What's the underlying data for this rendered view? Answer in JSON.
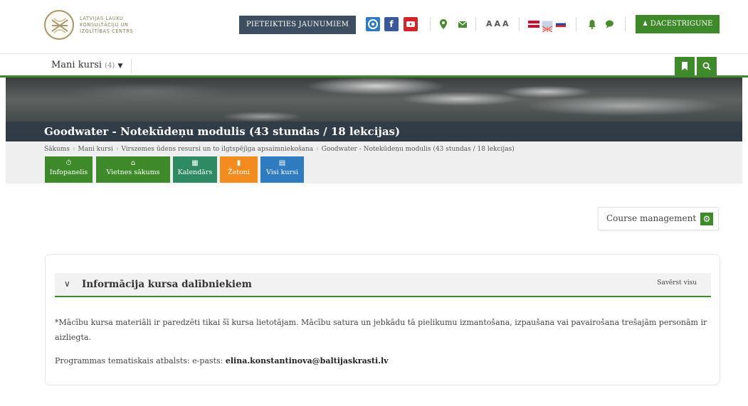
{
  "brand": {
    "logo_lines": [
      "LATVIJAS LAUKU",
      "KONSULTĀCIJU UN",
      "IZGLĪTĪBAS CENTRS"
    ],
    "accent": "#3e8a2a",
    "dark": "#3c4e5f"
  },
  "header": {
    "join_label": "PIETEIKTIES JAUNUMIEM",
    "font_sizes_label": "AAA",
    "user_label": "DACESTRIGUNE",
    "icons": [
      "draugiem-icon",
      "facebook-icon",
      "youtube-icon",
      "location-icon",
      "mail-icon",
      "flag-lv-icon",
      "flag-en-icon",
      "flag-ru-icon",
      "bell-icon",
      "chat-icon",
      "user-icon"
    ]
  },
  "nav": {
    "my_courses_label": "Mani kursi",
    "my_courses_count": "(4)"
  },
  "course": {
    "title": "Goodwater - Notekūdeņu modulis (43 stundas / 18 lekcijas)"
  },
  "breadcrumb": [
    "Sākums",
    "Mani kursi",
    "Virszemes ūdens resursi un to ilgtspējīga apsaimniekošana",
    "Goodwater - Notekūdeņu modulis (43 stundas / 18 lekcijas)"
  ],
  "quick_links": {
    "info": "Infopanelis",
    "home": "Vietnes sākums",
    "calendar": "Kalendārs",
    "badges": "Žetoni",
    "all_courses": "Visi kursi"
  },
  "course_management": {
    "label": "Course management"
  },
  "section": {
    "title": "Informācija kursa dalībniekiem",
    "collapse_label": "Savērst visu",
    "notice_text": "*Mācību kursa materiāli ir paredzēti  tikai šī kursa lietotājam. Mācību satura un jebkādu tā pielikumu izmantošana, izpaušana vai pavairošana trešajām personām ir  aizliegta.",
    "support_prefix": "Programmas tematiskais atbalsts:  e-pasts: ",
    "support_email": "elina.konstantinova@baltijaskrasti.lv"
  }
}
